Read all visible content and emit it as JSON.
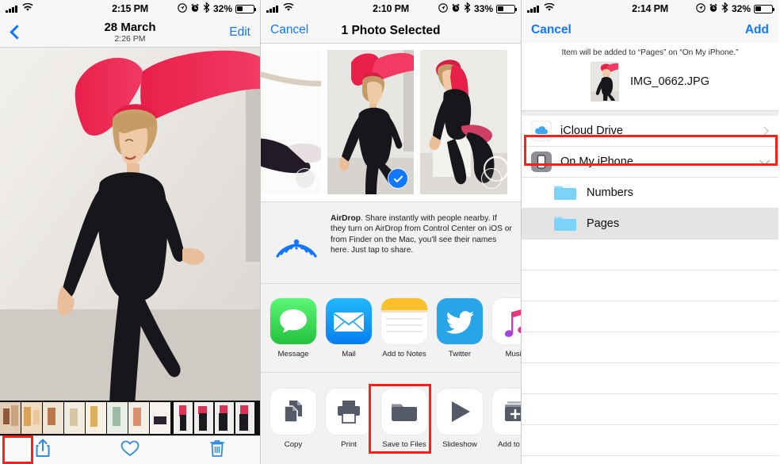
{
  "left_panel": {
    "status": {
      "time": "2:15 PM",
      "battery_pct": "32%",
      "icons": [
        "cellular-signal-icon",
        "wifi-icon",
        "location-arrow-icon",
        "alarm-clock-icon",
        "bluetooth-icon",
        "battery-icon"
      ]
    },
    "nav": {
      "back": "back-chevron-icon",
      "title": "28 March",
      "subtitle": "2:26 PM",
      "edit_label": "Edit"
    },
    "toolbar": {
      "share_label": "share-icon",
      "favorite_label": "heart-icon",
      "delete_label": "trash-icon"
    }
  },
  "mid_panel": {
    "status": {
      "time": "2:10 PM",
      "battery_pct": "33%"
    },
    "nav": {
      "cancel_label": "Cancel",
      "title": "1 Photo Selected"
    },
    "airdrop": {
      "title": "AirDrop",
      "body": ". Share instantly with people nearby. If they turn on AirDrop from Control Center on iOS or from Finder on the Mac, you'll see their names here. Just tap to share."
    },
    "apps": [
      {
        "label": "Message",
        "icon": "message-icon"
      },
      {
        "label": "Mail",
        "icon": "mail-icon"
      },
      {
        "label": "Add to Notes",
        "icon": "notes-icon"
      },
      {
        "label": "Twitter",
        "icon": "twitter-icon"
      },
      {
        "label": "Music",
        "icon": "music-icon"
      }
    ],
    "actions": [
      {
        "label": "Copy",
        "icon": "copy-icon",
        "highlighted": false
      },
      {
        "label": "Print",
        "icon": "printer-icon",
        "highlighted": false
      },
      {
        "label": "Save to Files",
        "icon": "folder-icon",
        "highlighted": true
      },
      {
        "label": "Slideshow",
        "icon": "play-icon",
        "highlighted": false
      },
      {
        "label": "Add to Alb",
        "icon": "add-to-album-icon",
        "highlighted": false
      }
    ],
    "thumbs": [
      {
        "selected": false
      },
      {
        "selected": true
      },
      {
        "selected": false
      }
    ]
  },
  "right_panel": {
    "status": {
      "time": "2:14 PM",
      "battery_pct": "32%"
    },
    "nav": {
      "cancel_label": "Cancel",
      "add_label": "Add"
    },
    "subtitle": "Item will be added to “Pages” on “On My iPhone.”",
    "filename": "IMG_0662.JPG",
    "locations": [
      {
        "label": "iCloud Drive",
        "icon": "icloud-icon",
        "accessory": "chevron-right",
        "indent": false,
        "selected": false,
        "highlighted": false
      },
      {
        "label": "On My iPhone",
        "icon": "iphone-icon",
        "accessory": "chevron-down",
        "indent": false,
        "selected": false,
        "highlighted": true
      },
      {
        "label": "Numbers",
        "icon": "folder-icon",
        "accessory": "none",
        "indent": true,
        "selected": false,
        "highlighted": false
      },
      {
        "label": "Pages",
        "icon": "folder-icon",
        "accessory": "none",
        "indent": true,
        "selected": true,
        "highlighted": false
      }
    ],
    "empty_rows": 7
  },
  "colors": {
    "accent_blue": "#1277ff",
    "highlight_red": "#fc2018",
    "folder_blue": "#7dd3f7",
    "selected_row": "#e4e4e4"
  }
}
